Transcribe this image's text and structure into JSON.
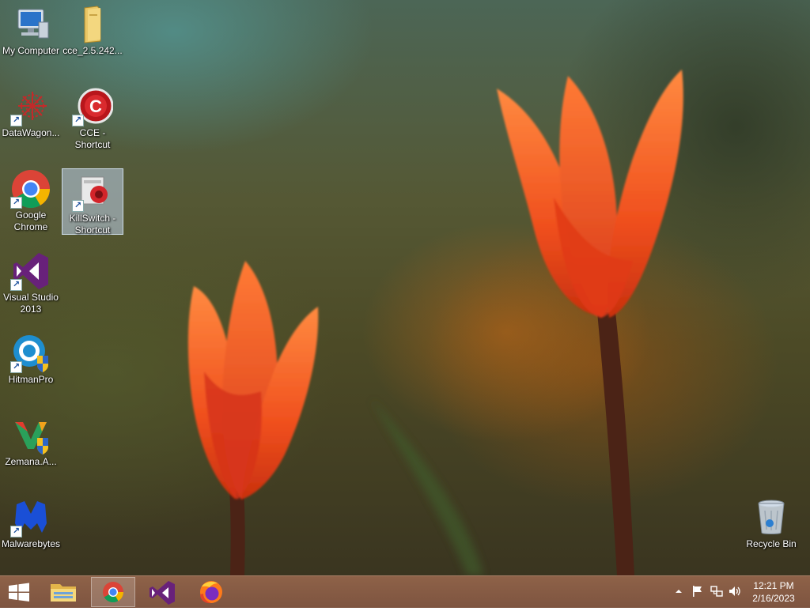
{
  "desktop": {
    "icons": [
      {
        "label": "My Computer"
      },
      {
        "label": "cce_2.5.242..."
      },
      {
        "label": "DataWagon..."
      },
      {
        "label": "CCE -\nShortcut"
      },
      {
        "label": "Google\nChrome"
      },
      {
        "label": "KillSwitch -\nShortcut"
      },
      {
        "label": "Visual Studio\n2013"
      },
      {
        "label": "HitmanPro"
      },
      {
        "label": "Zemana.A..."
      },
      {
        "label": "Malwarebytes"
      },
      {
        "label": "Recycle Bin"
      }
    ]
  },
  "taskbar": {
    "clock_time": "12:21 PM",
    "clock_date": "2/16/2023"
  },
  "colors": {
    "taskbar": "#7e5440",
    "tulip_red": "#e8391a",
    "tulip_orange": "#f06a24",
    "chrome_red": "#db4437",
    "chrome_green": "#0f9d58",
    "chrome_yellow": "#f4b400",
    "chrome_blue": "#4285f4",
    "vs_purple": "#68217a"
  }
}
